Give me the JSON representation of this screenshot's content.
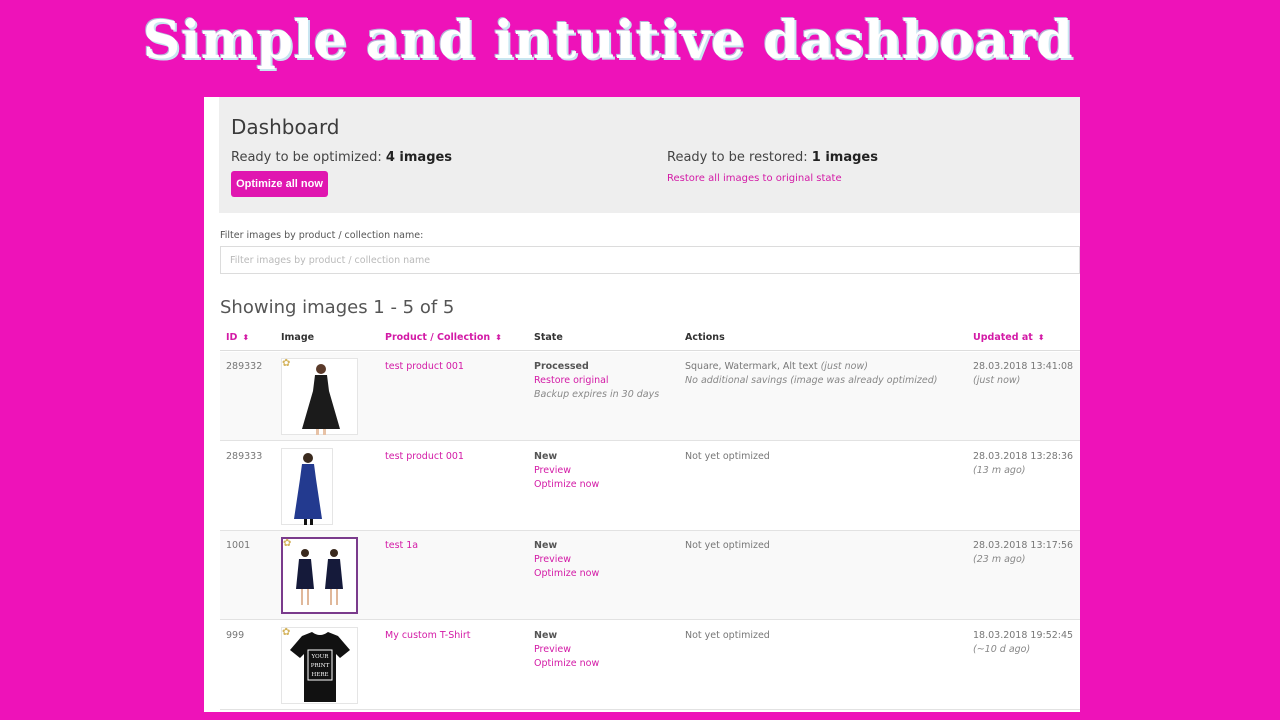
{
  "headline": "Simple and intuitive dashboard",
  "dashboard": {
    "title": "Dashboard",
    "ready_optimized_label": "Ready to be optimized:",
    "ready_optimized_value": "4 images",
    "optimize_all_label": "Optimize all now",
    "ready_restored_label": "Ready to be restored:",
    "ready_restored_value": "1 images",
    "restore_all_label": "Restore all images to original state"
  },
  "filter": {
    "label": "Filter images by product / collection name:",
    "placeholder": "Filter images by product / collection name"
  },
  "showing": "Showing images 1 - 5 of 5",
  "table": {
    "columns": {
      "id": "ID",
      "image": "Image",
      "product": "Product / Collection",
      "state": "State",
      "actions": "Actions",
      "updated": "Updated at"
    },
    "rows": [
      {
        "id": "289332",
        "product": "test product 001",
        "state": "Processed",
        "link1": "Restore original",
        "note": "Backup expires in 30 days",
        "action_main": "Square, Watermark, Alt text",
        "action_time": "(just now)",
        "action_note": "No additional savings (image was already optimized)",
        "updated": "28.03.2018 13:41:08",
        "updated_rel": "(just now)"
      },
      {
        "id": "289333",
        "product": "test product 001",
        "state": "New",
        "link1": "Preview",
        "link2": "Optimize now",
        "action_main": "Not yet optimized",
        "updated": "28.03.2018 13:28:36",
        "updated_rel": "(13 m ago)"
      },
      {
        "id": "1001",
        "product": "test 1a",
        "state": "New",
        "link1": "Preview",
        "link2": "Optimize now",
        "action_main": "Not yet optimized",
        "updated": "28.03.2018 13:17:56",
        "updated_rel": "(23 m ago)"
      },
      {
        "id": "999",
        "product": "My custom T-Shirt",
        "state": "New",
        "link1": "Preview",
        "link2": "Optimize now",
        "action_main": "Not yet optimized",
        "updated": "18.03.2018 19:52:45",
        "updated_rel": "(~10 d ago)",
        "tshirt_text": [
          "YOUR",
          "PRINT",
          "HERE"
        ]
      }
    ]
  },
  "colors": {
    "background": "#ee12b9",
    "accent": "#d31aa6",
    "button": "#e016b0"
  }
}
